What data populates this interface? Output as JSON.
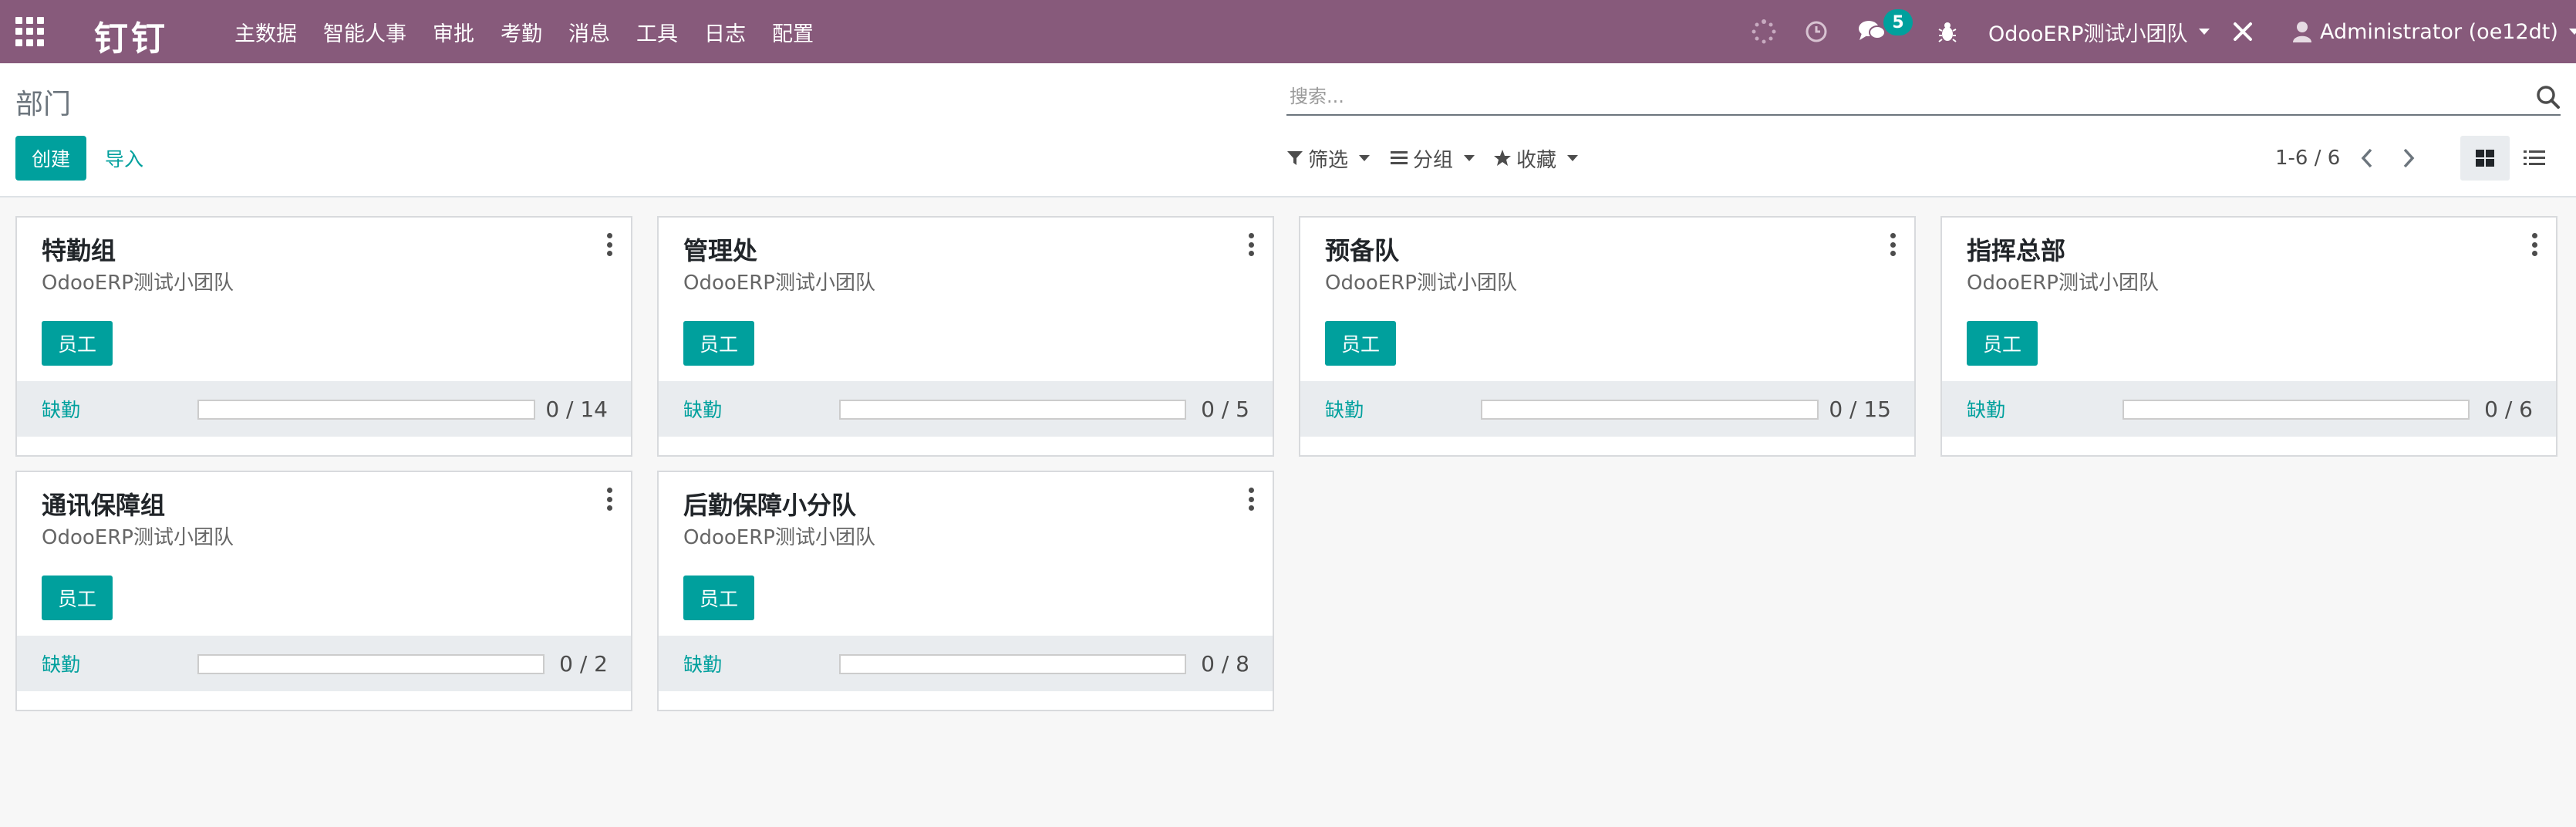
{
  "navbar": {
    "brand": "钉钉",
    "menu": [
      "主数据",
      "智能人事",
      "审批",
      "考勤",
      "消息",
      "工具",
      "日志",
      "配置"
    ],
    "message_count": "5",
    "company": "OdooERP测试小团队",
    "user": "Administrator (oe12dt)"
  },
  "control_panel": {
    "breadcrumb": "部门",
    "search_placeholder": "搜索...",
    "create_label": "创建",
    "import_label": "导入",
    "filter_label": "筛选",
    "group_label": "分组",
    "favorites_label": "收藏",
    "pager": "1-6 / 6"
  },
  "colors": {
    "navbar": "#875a7b",
    "accent": "#00a09d"
  },
  "cards": [
    {
      "title": "特勤组",
      "company": "OdooERP测试小团队",
      "button": "员工",
      "footer_label": "缺勤",
      "absent": 0,
      "total": 14,
      "count_text": "0 / 14"
    },
    {
      "title": "管理处",
      "company": "OdooERP测试小团队",
      "button": "员工",
      "footer_label": "缺勤",
      "absent": 0,
      "total": 5,
      "count_text": "0 / 5"
    },
    {
      "title": "预备队",
      "company": "OdooERP测试小团队",
      "button": "员工",
      "footer_label": "缺勤",
      "absent": 0,
      "total": 15,
      "count_text": "0 / 15"
    },
    {
      "title": "指挥总部",
      "company": "OdooERP测试小团队",
      "button": "员工",
      "footer_label": "缺勤",
      "absent": 0,
      "total": 6,
      "count_text": "0 / 6"
    },
    {
      "title": "通讯保障组",
      "company": "OdooERP测试小团队",
      "button": "员工",
      "footer_label": "缺勤",
      "absent": 0,
      "total": 2,
      "count_text": "0 / 2"
    },
    {
      "title": "后勤保障小分队",
      "company": "OdooERP测试小团队",
      "button": "员工",
      "footer_label": "缺勤",
      "absent": 0,
      "total": 8,
      "count_text": "0 / 8"
    }
  ]
}
